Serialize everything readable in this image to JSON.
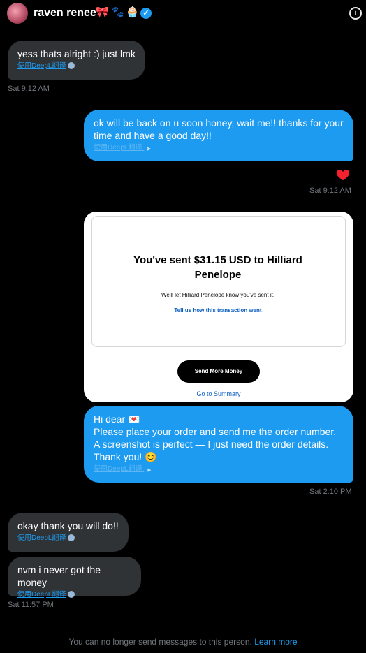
{
  "header": {
    "name": "raven renee",
    "emojis": [
      "🎀",
      "🐾",
      "🧁"
    ],
    "verified_glyph": "✓",
    "info_glyph": "i"
  },
  "translate_label": "使用DeepL翻译",
  "messages": {
    "m1": {
      "text": "yess thats alright :) just lmk",
      "time": "Sat 9:12 AM"
    },
    "m2": {
      "text": "ok will be back on u soon honey, wait me!! thanks for your time and have a good day!!",
      "time": "Sat 9:12 AM",
      "reaction": "heart"
    },
    "m3": {
      "card": {
        "title": "You've sent $31.15 USD to Hilliard Penelope",
        "subtitle": "We'll let Hilliard Penelope know you've sent it.",
        "feedback_link": "Tell us how this transaction went",
        "button": "Send More Money",
        "summary_link": "Go to Summary"
      }
    },
    "m4": {
      "line1": "Hi dear 💌",
      "line2": "Please place your order and send me the order number.",
      "line3": "A screenshot is perfect — I just need the order details.",
      "line4": "Thank you! 😊",
      "time": "Sat 2:10 PM"
    },
    "m5": {
      "text": "okay thank you will do!!"
    },
    "m6": {
      "text": "nvm i never got the money",
      "time": "Sat 11:57 PM"
    }
  },
  "footer": {
    "notice": "You can no longer send messages to this person.",
    "link": "Learn more"
  },
  "colors": {
    "background": "#000000",
    "received_bubble": "#2f3336",
    "sent_bubble": "#1d9bf0",
    "link": "#1d9bf0",
    "heart": "#f91880"
  }
}
